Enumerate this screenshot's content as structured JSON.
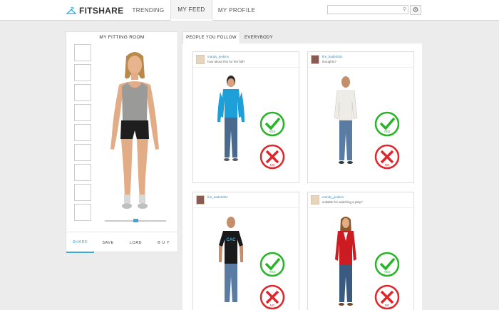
{
  "app": {
    "brand": "FITSHARE"
  },
  "nav": {
    "trending": "TRENDING",
    "my_feed": "MY FEED",
    "my_profile": "MY PROFILE"
  },
  "search": {
    "placeholder": ""
  },
  "fitting_room": {
    "title": "MY FITTING ROOM",
    "actions": {
      "share": "SHARE",
      "save": "SAVE",
      "load": "LOAD",
      "buy": "B U Y"
    },
    "slider_value": 0.5
  },
  "feed": {
    "tabs": {
      "following": "PEOPLE YOU FOLLOW",
      "everybody": "EVERYBODY"
    },
    "cards": [
      {
        "user": "mandy_jenkins",
        "message": "how about this for the fall?",
        "shirt": "#1e9fd8",
        "pants": "#4a6a8e"
      },
      {
        "user": "fire_bade2001",
        "message": "thoughts?",
        "shirt": "#eeece6",
        "pants": "#5a7ca3"
      },
      {
        "user": "fire_bade2001",
        "message": "",
        "shirt": "#1a1a1a",
        "pants": "#5a7ca3",
        "shirt_text": "CAC"
      },
      {
        "user": "mandy_jenkins",
        "message": "suitable for watching a play?",
        "shirt": "#cc1c22",
        "pants": "#3b5a80"
      }
    ],
    "vote": {
      "yes": "YES",
      "no": "NO"
    }
  },
  "colors": {
    "accent": "#3aa8dd",
    "yes": "#27b427",
    "no": "#e0262b"
  }
}
